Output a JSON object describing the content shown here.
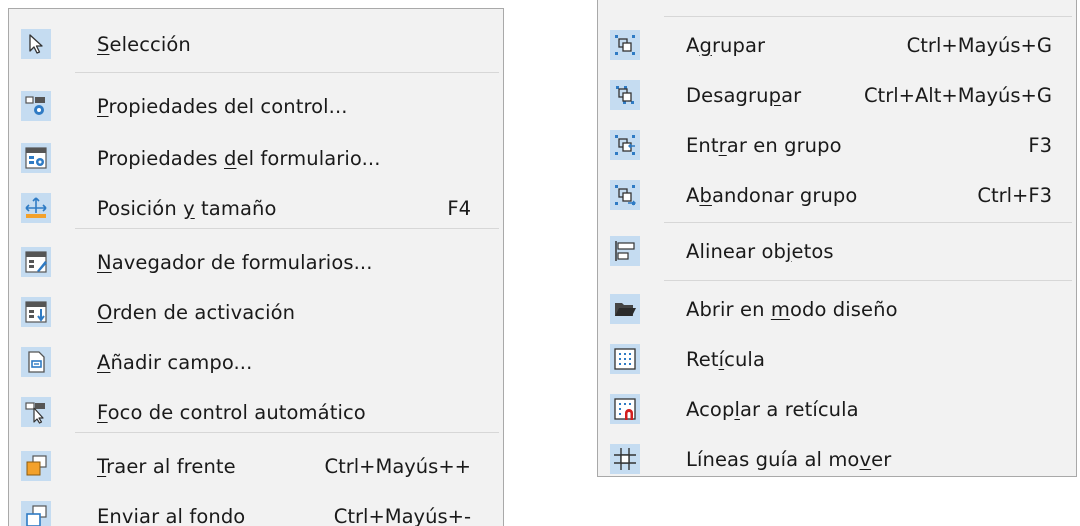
{
  "colors": {
    "menu_bg": "#f2f2f2",
    "icon_bg": "#c5dcf1",
    "icon_blue": "#2f7bc4",
    "text": "#1a1a1a",
    "separator": "#d7d7d7",
    "orange": "#f3a12b",
    "red": "#d21f1f"
  },
  "left_menu": {
    "items": [
      {
        "icon": "cursor-arrow-icon",
        "label": "Selección",
        "access_pre": "",
        "access_key": "S",
        "access_post": "elección",
        "shortcut": ""
      },
      {
        "icon": "control-properties-icon",
        "label": "Propiedades del control...",
        "access_pre": "",
        "access_key": "P",
        "access_post": "ropiedades del control...",
        "shortcut": ""
      },
      {
        "icon": "form-properties-icon",
        "label": "Propiedades del formulario...",
        "access_pre": "Propiedades ",
        "access_key": "d",
        "access_post": "el formulario...",
        "shortcut": ""
      },
      {
        "icon": "position-size-icon",
        "label": "Posición y tamaño",
        "access_pre": "Posición ",
        "access_key": "y",
        "access_post": " tamaño",
        "shortcut": "F4"
      },
      {
        "icon": "form-navigator-icon",
        "label": "Navegador de formularios...",
        "access_pre": "",
        "access_key": "N",
        "access_post": "avegador de formularios...",
        "shortcut": ""
      },
      {
        "icon": "tab-order-icon",
        "label": "Orden de activación",
        "access_pre": "",
        "access_key": "O",
        "access_post": "rden de activación",
        "shortcut": ""
      },
      {
        "icon": "add-field-icon",
        "label": "Añadir campo...",
        "access_pre": "",
        "access_key": "A",
        "access_post": "ñadir campo...",
        "shortcut": ""
      },
      {
        "icon": "auto-focus-icon",
        "label": "Foco de control automático",
        "access_pre": "",
        "access_key": "F",
        "access_post": "oco de control automático",
        "shortcut": ""
      },
      {
        "icon": "bring-to-front-icon",
        "label": "Traer al frente",
        "access_pre": "",
        "access_key": "T",
        "access_post": "raer al frente",
        "shortcut": "Ctrl+Mayús++"
      },
      {
        "icon": "send-to-back-icon",
        "label": "Enviar al fondo",
        "access_pre": "",
        "access_key": "E",
        "access_post": "nviar al fondo",
        "shortcut": "Ctrl+Mayús+-"
      }
    ]
  },
  "right_menu": {
    "items": [
      {
        "icon": "group-icon",
        "label": "Agrupar",
        "access_pre": "A",
        "access_key": "g",
        "access_post": "rupar",
        "shortcut": "Ctrl+Mayús+G"
      },
      {
        "icon": "ungroup-icon",
        "label": "Desagrupar",
        "access_pre": "Desagru",
        "access_key": "p",
        "access_post": "ar",
        "shortcut": "Ctrl+Alt+Mayús+G"
      },
      {
        "icon": "enter-group-icon",
        "label": "Entrar en grupo",
        "access_pre": "Ent",
        "access_key": "r",
        "access_post": "ar en grupo",
        "shortcut": "F3"
      },
      {
        "icon": "exit-group-icon",
        "label": "Abandonar grupo",
        "access_pre": "A",
        "access_key": "b",
        "access_post": "andonar grupo",
        "shortcut": "Ctrl+F3"
      },
      {
        "icon": "align-objects-icon",
        "label": "Alinear objetos",
        "access_pre": "Alinear ob",
        "access_key": "j",
        "access_post": "etos",
        "shortcut": ""
      },
      {
        "icon": "open-folder-icon",
        "label": "Abrir en modo diseño",
        "access_pre": "Abrir en ",
        "access_key": "m",
        "access_post": "odo diseño",
        "shortcut": ""
      },
      {
        "icon": "grid-icon",
        "label": "Retícula",
        "access_pre": "Ret",
        "access_key": "í",
        "access_post": "cula",
        "shortcut": ""
      },
      {
        "icon": "snap-to-grid-icon",
        "label": "Acoplar a retícula",
        "access_pre": "Acop",
        "access_key": "l",
        "access_post": "ar a retícula",
        "shortcut": ""
      },
      {
        "icon": "guides-when-moving-icon",
        "label": "Líneas guía al mover",
        "access_pre": "Líneas guía al mo",
        "access_key": "v",
        "access_post": "er",
        "shortcut": ""
      }
    ]
  }
}
